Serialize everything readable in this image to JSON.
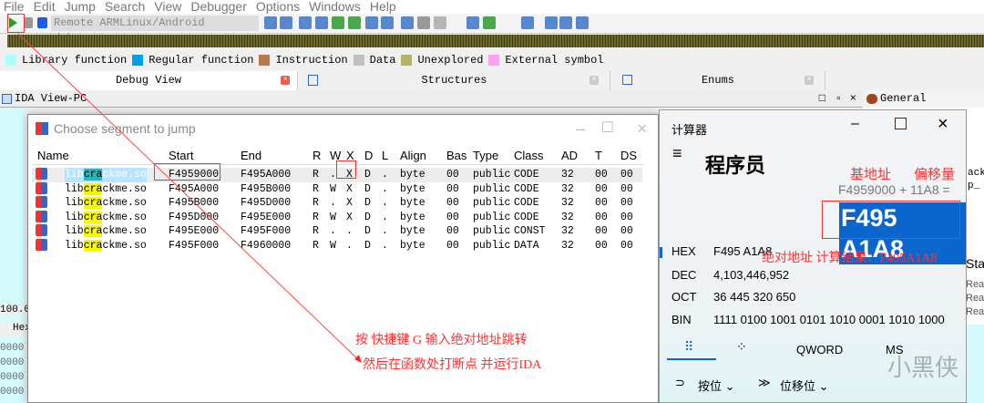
{
  "menu": [
    "File",
    "Edit",
    "Jump",
    "Search",
    "View",
    "Debugger",
    "Options",
    "Windows",
    "Help"
  ],
  "toolbar": {
    "debugger_select": "Remote ARMLinux/Android debugger",
    "icons": [
      "play-icon",
      "pause-icon",
      "stop-icon"
    ]
  },
  "legend": [
    {
      "label": "Library function",
      "color": "#aaffff"
    },
    {
      "label": "Regular function",
      "color": "#00a0e8"
    },
    {
      "label": "Instruction",
      "color": "#b87850"
    },
    {
      "label": "Data",
      "color": "#c0c0c0"
    },
    {
      "label": "Unexplored",
      "color": "#b4b464"
    },
    {
      "label": "External symbol",
      "color": "#ffa0f0"
    }
  ],
  "tabs": [
    {
      "label": "Debug View"
    },
    {
      "label": "Structures"
    },
    {
      "label": "Enums"
    }
  ],
  "ida_view": {
    "title": "IDA View-PC"
  },
  "registers": {
    "title": "General registers"
  },
  "left": {
    "zoom": "100.0",
    "hex_tab": "Hex",
    "lines": [
      "0000",
      "0000",
      "0000",
      "0000"
    ]
  },
  "dialog": {
    "title": "Choose segment to jump",
    "columns": [
      "Name",
      "Start",
      "End",
      "R",
      "W",
      "X",
      "D",
      "L",
      "Align",
      "Bas",
      "Type",
      "Class",
      "AD",
      "T",
      "DS"
    ],
    "rows": [
      [
        "libcrackme.so",
        "F4959000",
        "F495A000",
        "R",
        ".",
        "X",
        "D",
        ".",
        "byte",
        "00",
        "public",
        "CODE",
        "32",
        "00",
        "00"
      ],
      [
        "libcrackme.so",
        "F495A000",
        "F495B000",
        "R",
        "W",
        "X",
        "D",
        ".",
        "byte",
        "00",
        "public",
        "CODE",
        "32",
        "00",
        "00"
      ],
      [
        "libcrackme.so",
        "F495B000",
        "F495D000",
        "R",
        ".",
        "X",
        "D",
        ".",
        "byte",
        "00",
        "public",
        "CODE",
        "32",
        "00",
        "00"
      ],
      [
        "libcrackme.so",
        "F495D000",
        "F495E000",
        "R",
        "W",
        "X",
        "D",
        ".",
        "byte",
        "00",
        "public",
        "CODE",
        "32",
        "00",
        "00"
      ],
      [
        "libcrackme.so",
        "F495E000",
        "F495F000",
        "R",
        ".",
        ".",
        "D",
        ".",
        "byte",
        "00",
        "public",
        "CONST",
        "32",
        "00",
        "00"
      ],
      [
        "libcrackme.so",
        "F495F000",
        "F4960000",
        "R",
        "W",
        ".",
        "D",
        ".",
        "byte",
        "00",
        "public",
        "DATA",
        "32",
        "00",
        "00"
      ]
    ]
  },
  "calculator": {
    "app_title": "计算器",
    "mode": "程序员",
    "expression": "F4959000 + 11A8 =",
    "result": "F495 A1A8",
    "radix": [
      {
        "label": "HEX",
        "value": "F495 A1A8"
      },
      {
        "label": "DEC",
        "value": "4,103,446,952"
      },
      {
        "label": "OCT",
        "value": "36 445 320 650"
      },
      {
        "label": "BIN",
        "value": "1111 0100 1001 0101 1010 0001 1010 1000"
      }
    ],
    "word_size": "QWORD",
    "memory": "MS",
    "bitwise": "按位",
    "bitshift": "位移位"
  },
  "annotations": {
    "base": "基地址",
    "offset": "偏移量",
    "result": "绝对地址 计算结果：F495A1A8",
    "line1": "按 快捷键 G 输入绝对地址跳转",
    "line2": "然后在函数处打断点 并运行IDA"
  },
  "right_fragments": [
    "ack",
    "p_",
    "Sta",
    "Rea",
    "Rea",
    "Rea"
  ],
  "watermark": "小黑侠"
}
